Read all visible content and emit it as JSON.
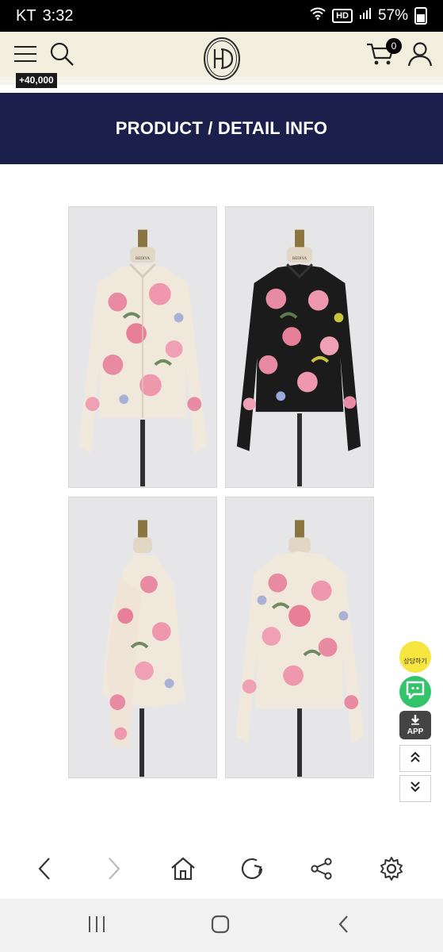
{
  "status": {
    "carrier": "KT",
    "time": "3:32",
    "hd": "HD",
    "battery": "57%"
  },
  "header": {
    "logo_icon": "hd-monogram-logo",
    "points": "+40,000",
    "cart_count": "0"
  },
  "banner": {
    "title": "PRODUCT / DETAIL INFO"
  },
  "products": [
    {
      "icon": "floral-blouse-ivory-front",
      "label": "BEDIYA"
    },
    {
      "icon": "floral-blouse-black-front",
      "label": "BEDIYA"
    },
    {
      "icon": "floral-blouse-ivory-side"
    },
    {
      "icon": "floral-blouse-ivory-back"
    }
  ],
  "floating": {
    "kakao_label": "상담하기",
    "app_label": "APP"
  },
  "colors": {
    "banner_bg": "#1b1f4c",
    "header_bg": "#f3efdf",
    "kakao": "#f7e540",
    "talk": "#33c36a"
  }
}
